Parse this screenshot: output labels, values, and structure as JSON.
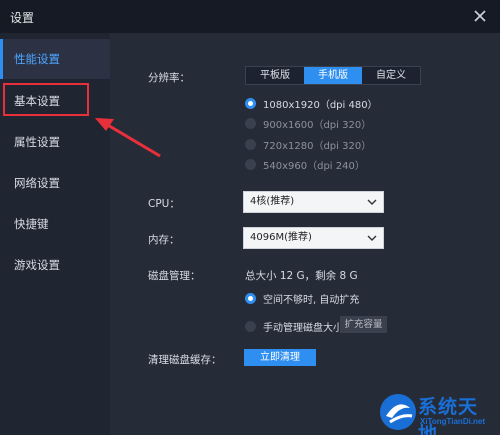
{
  "window": {
    "title": "设置"
  },
  "sidebar": {
    "items": [
      {
        "label": "性能设置",
        "active": true
      },
      {
        "label": "基本设置",
        "active": false
      },
      {
        "label": "属性设置",
        "active": false
      },
      {
        "label": "网络设置",
        "active": false
      },
      {
        "label": "快捷键",
        "active": false
      },
      {
        "label": "游戏设置",
        "active": false
      }
    ]
  },
  "resolution": {
    "label": "分辨率：",
    "tabs": [
      "平板版",
      "手机版",
      "自定义"
    ],
    "selected_tab": "手机版",
    "options": [
      {
        "label": "1080x1920（dpi 480）",
        "selected": true
      },
      {
        "label": "900x1600（dpi 320）",
        "selected": false
      },
      {
        "label": "720x1280（dpi 320）",
        "selected": false
      },
      {
        "label": "540x960（dpi 240）",
        "selected": false
      }
    ]
  },
  "cpu": {
    "label": "CPU：",
    "value": "4核(推荐)"
  },
  "memory": {
    "label": "内存：",
    "value": "4096M(推荐)"
  },
  "disk": {
    "label": "磁盘管理：",
    "summary": "总大小 12 G，剩余 8 G",
    "options": [
      {
        "label": "空间不够时, 自动扩充",
        "selected": true
      },
      {
        "label": "手动管理磁盘大小",
        "selected": false
      }
    ],
    "expand_button": "扩充容量"
  },
  "cache": {
    "label": "清理磁盘缓存：",
    "button": "立即清理"
  },
  "watermark": {
    "brand": "系统天地",
    "site": "XiTongTianDi.net"
  },
  "colors": {
    "accent": "#2f8ff0",
    "highlight": "#e8303a",
    "background": "#262b38"
  }
}
